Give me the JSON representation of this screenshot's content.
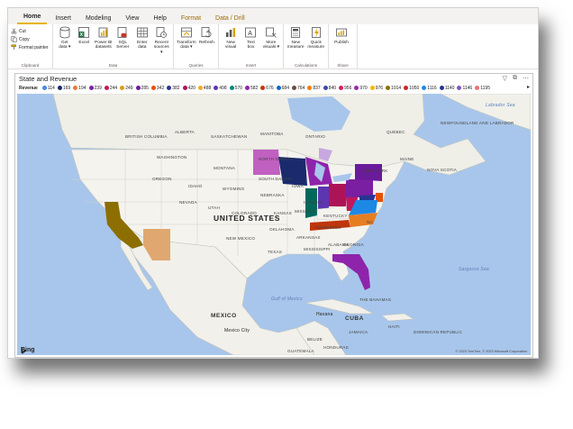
{
  "tabs": [
    "Home",
    "Insert",
    "Modeling",
    "View",
    "Help",
    "Format",
    "Data / Drill"
  ],
  "ribbon": {
    "clipboard": {
      "cut": "Cut",
      "copy": "Copy",
      "format_painter": "Format painter",
      "label": "Clipboard"
    },
    "data": {
      "buttons": [
        {
          "line1": "Get",
          "line2": "data ▾"
        },
        {
          "line1": "Excel",
          "line2": ""
        },
        {
          "line1": "Power BI",
          "line2": "datasets"
        },
        {
          "line1": "SQL",
          "line2": "Server"
        },
        {
          "line1": "Enter",
          "line2": "data"
        },
        {
          "line1": "Recent",
          "line2": "sources ▾"
        }
      ],
      "label": "Data"
    },
    "queries": {
      "buttons": [
        {
          "line1": "Transform",
          "line2": "data ▾"
        },
        {
          "line1": "Refresh",
          "line2": ""
        }
      ],
      "label": "Queries"
    },
    "insert": {
      "buttons": [
        {
          "line1": "New",
          "line2": "visual"
        },
        {
          "line1": "Text",
          "line2": "box"
        },
        {
          "line1": "More",
          "line2": "visuals ▾"
        }
      ],
      "label": "Insert"
    },
    "calculations": {
      "buttons": [
        {
          "line1": "New",
          "line2": "measure"
        },
        {
          "line1": "Quick",
          "line2": "measure"
        }
      ],
      "label": "Calculations"
    },
    "share": {
      "buttons": [
        {
          "line1": "Publish",
          "line2": ""
        }
      ],
      "label": "Share"
    }
  },
  "visual": {
    "title": "State and Revenue",
    "legend_title": "Revenue",
    "legend": [
      {
        "label": "114",
        "color": "#4a86e8"
      },
      {
        "label": "169",
        "color": "#1a2a6c"
      },
      {
        "label": "194",
        "color": "#e8793a"
      },
      {
        "label": "239",
        "color": "#7b1fa2"
      },
      {
        "label": "244",
        "color": "#c2185b"
      },
      {
        "label": "249",
        "color": "#d4a017"
      },
      {
        "label": "285",
        "color": "#6a1b9a"
      },
      {
        "label": "342",
        "color": "#e65100"
      },
      {
        "label": "382",
        "color": "#283593"
      },
      {
        "label": "420",
        "color": "#ad1457"
      },
      {
        "label": "488",
        "color": "#f9a825"
      },
      {
        "label": "498",
        "color": "#5e35b1"
      },
      {
        "label": "570",
        "color": "#00897b"
      },
      {
        "label": "582",
        "color": "#8e24aa"
      },
      {
        "label": "676",
        "color": "#bf360c"
      },
      {
        "label": "684",
        "color": "#1565c0"
      },
      {
        "label": "764",
        "color": "#6d4c41"
      },
      {
        "label": "837",
        "color": "#f57c00"
      },
      {
        "label": "840",
        "color": "#3949ab"
      },
      {
        "label": "956",
        "color": "#d81b60"
      },
      {
        "label": "970",
        "color": "#9c27b0"
      },
      {
        "label": "976",
        "color": "#ffb300"
      },
      {
        "label": "1014",
        "color": "#8d6e00"
      },
      {
        "label": "1050",
        "color": "#c62828"
      },
      {
        "label": "1116",
        "color": "#1e88e5"
      },
      {
        "label": "1140",
        "color": "#283593"
      },
      {
        "label": "1146",
        "color": "#7e57c2"
      },
      {
        "label": "1195",
        "color": "#e57373"
      }
    ],
    "map_labels": {
      "country": "UNITED STATES",
      "mexico": "MEXICO",
      "mexico_city": "Mexico City",
      "gulf": "Gulf of Mexico",
      "cuba": "CUBA",
      "havana": "Havana",
      "bahamas": "THE BAHAMAS",
      "jamaica": "JAMAICA",
      "haiti": "HAITI",
      "dom_rep": "DOMINICAN REPUBLIC",
      "belize": "BELIZE",
      "honduras": "HONDURAS",
      "guatemala": "GUATEMALA",
      "nicaragua": "NICARAGUA",
      "sargasso": "Sargasso Sea",
      "labrador": "Labrador Sea",
      "states": [
        "WASHINGTON",
        "OREGON",
        "IDAHO",
        "MONTANA",
        "NORTH DAKOTA",
        "SOUTH DAKOTA",
        "WYOMING",
        "NEBRASKA",
        "NEVADA",
        "UTAH",
        "COLORADO",
        "KANSAS",
        "OKLAHOMA",
        "NEW MEXICO",
        "TEXAS",
        "IOWA",
        "MISSOURI",
        "ARKANSAS",
        "ILLINOIS",
        "KENTUCKY",
        "TENNESSEE",
        "ALABAMA",
        "MISSISSIPPI",
        "GEORGIA",
        "NC",
        "NEW YORK",
        "MAINE",
        "QUÉBEC",
        "ONTARIO",
        "MANITOBA",
        "SASKATCHEWAN",
        "ALBERTA",
        "BRITISH COLUMBIA",
        "NEWFOUNDLAND AND LABRADOR",
        "NOVA SCOTIA"
      ]
    },
    "bing": "Bing",
    "copyright": "© 2023 TomTom, © 2023 Microsoft Corporation"
  }
}
